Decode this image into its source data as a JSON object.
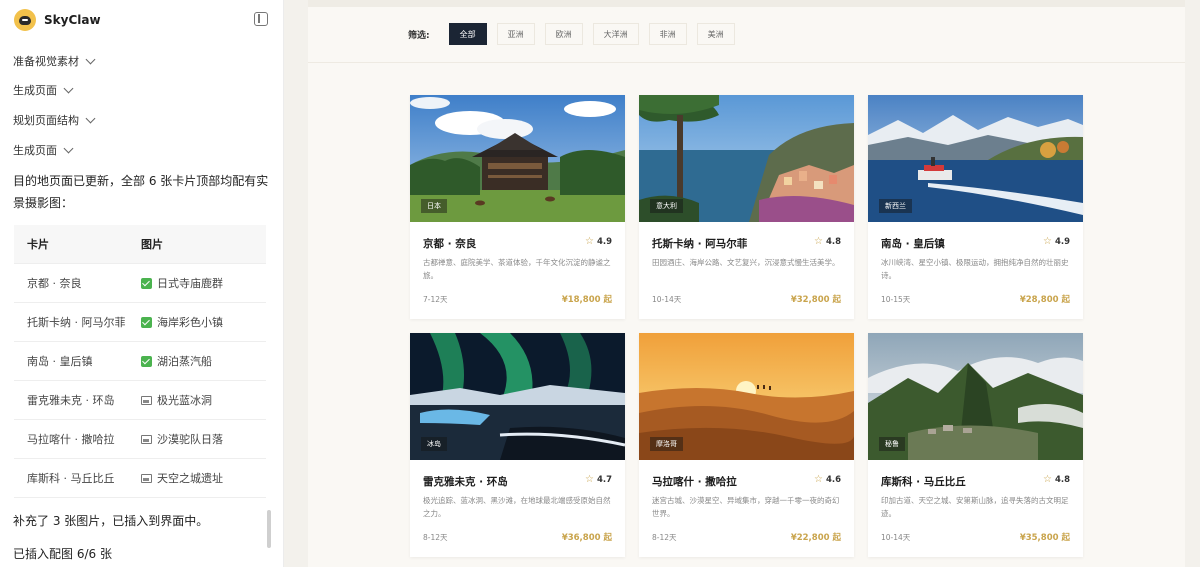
{
  "app": {
    "title": "SkyClaw"
  },
  "chat": {
    "steps": [
      {
        "label": "准备视觉素材"
      },
      {
        "label": "生成页面"
      },
      {
        "label": "规划页面结构"
      },
      {
        "label": "生成页面"
      }
    ],
    "message_1": "目的地页面已更新，全部 6 张卡片顶部均配有实景摄影图：",
    "table": {
      "headers": [
        "卡片",
        "图片"
      ],
      "rows": [
        {
          "card": "京都 · 奈良",
          "image": "日式寺庙鹿群",
          "status": "done"
        },
        {
          "card": "托斯卡纳 · 阿马尔菲",
          "image": "海岸彩色小镇",
          "status": "done"
        },
        {
          "card": "南岛 · 皇后镇",
          "image": "湖泊蒸汽船",
          "status": "done"
        },
        {
          "card": "雷克雅未克 · 环岛",
          "image": "极光蓝冰洞",
          "status": "image"
        },
        {
          "card": "马拉喀什 · 撒哈拉",
          "image": "沙漠驼队日落",
          "status": "image"
        },
        {
          "card": "库斯科 · 马丘比丘",
          "image": "天空之城遗址",
          "status": "image"
        }
      ]
    },
    "message_2": "补充了 3 张图片，已插入到界面中。",
    "message_3": "已插入配图 6/6 张"
  },
  "preview": {
    "filter": {
      "label": "筛选:",
      "options": [
        "全部",
        "亚洲",
        "欧洲",
        "大洋洲",
        "非洲",
        "美洲"
      ],
      "selected": "全部"
    },
    "cards": [
      {
        "tag": "日本",
        "title": "京都 · 奈良",
        "rating": "4.9",
        "desc": "古都禅意、庭院美学、茶道体验，千年文化沉淀的静谧之旅。",
        "days": "7-12天",
        "price": "¥18,800 起",
        "scene": "temple"
      },
      {
        "tag": "意大利",
        "title": "托斯卡纳 · 阿马尔菲",
        "rating": "4.8",
        "desc": "田园酒庄、海岸公路、文艺复兴，沉浸意式慢生活美学。",
        "days": "10-14天",
        "price": "¥32,800 起",
        "scene": "coast"
      },
      {
        "tag": "新西兰",
        "title": "南岛 · 皇后镇",
        "rating": "4.9",
        "desc": "冰川峡湾、星空小镇、极限运动，拥抱纯净自然的壮丽史诗。",
        "days": "10-15天",
        "price": "¥28,800 起",
        "scene": "lake"
      },
      {
        "tag": "冰岛",
        "title": "雷克雅未克 · 环岛",
        "rating": "4.7",
        "desc": "极光追踪、蓝冰洞、黑沙滩，在地球最北端感受原始自然之力。",
        "days": "8-12天",
        "price": "¥36,800 起",
        "scene": "aurora"
      },
      {
        "tag": "摩洛哥",
        "title": "马拉喀什 · 撒哈拉",
        "rating": "4.6",
        "desc": "迷宫古城、沙漠星空、异域集市，穿越一千零一夜的奇幻世界。",
        "days": "8-12天",
        "price": "¥22,800 起",
        "scene": "desert"
      },
      {
        "tag": "秘鲁",
        "title": "库斯科 · 马丘比丘",
        "rating": "4.8",
        "desc": "印加古道、天空之城、安第斯山脉，追寻失落的古文明足迹。",
        "days": "10-14天",
        "price": "¥35,800 起",
        "scene": "machu"
      }
    ]
  },
  "colors": {
    "accent_gold": "#c9a44c",
    "active_chip": "#1b2534",
    "check_green": "#4bb34f"
  }
}
